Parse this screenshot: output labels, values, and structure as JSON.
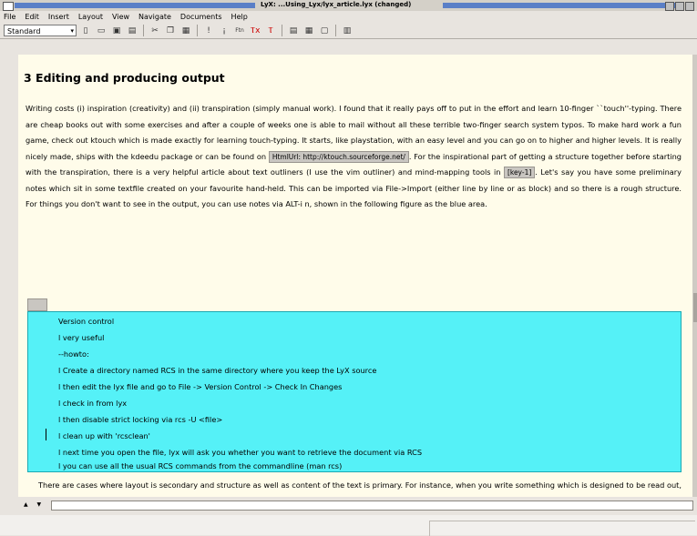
{
  "window": {
    "title": "LyX: ...Using_Lyx/lyx_article.lyx (changed)"
  },
  "menu": [
    "File",
    "Edit",
    "Insert",
    "Layout",
    "View",
    "Navigate",
    "Documents",
    "Help"
  ],
  "toolbar": {
    "layout_value": "Standard",
    "dropdown_arrow": "▾",
    "icons": [
      "new-icon",
      "open-icon",
      "save-icon",
      "print-icon",
      "cut-icon",
      "copy-icon",
      "paste-icon",
      "emph-icon",
      "noun-icon",
      "footnote-icon",
      "math-icon",
      "tex-icon",
      "table-icon",
      "figure-icon",
      "minipage-icon",
      "list-icon"
    ],
    "glyphs": {
      "new": "▯",
      "open": "▭",
      "save": "▣",
      "print": "▤",
      "cut": "✂",
      "copy": "❐",
      "paste": "▦",
      "emph": "!",
      "noun": "¡",
      "footnote": "Ftn",
      "math": "Ⲧx",
      "tex": "Ⲧ",
      "table": "▤",
      "figure": "▦",
      "minipage": "▢",
      "list": "▥"
    }
  },
  "document": {
    "heading": "3   Editing and producing output",
    "para1_before_url": "Writing costs (i) inspiration (creativity) and (ii) transpiration (simply manual work). I found that it really pays off to put in the effort and learn 10-finger ``touch''-typing. There are cheap books out with some exercises and after a couple of weeks one is able to mail without all these terrible two-finger search system typos. To make hard work a fun game, check out ktouch which is made exactly for learning touch-typing. It starts, like playstation, with an easy level and you can go on to higher and higher levels. It is really nicely made, ships with the kdeedu package or can be found on",
    "url_inset": "HtmlUrl: http://ktouch.sourceforge.net/",
    "para1_middle": ". For the inspirational part of getting a structure together before starting with the transpiration, there is a very helpful article about text outliners (I use the vim outliner) and mind-mapping tools in",
    "ref_inset": "[key-1]",
    "para1_after": ". Let's say you have some preliminary notes which sit in some textfile created on your favourite hand-held. This can be imported via File->Import (either line by line or as block) and so there is a rough structure. For things you don't want to see in the output, you can use notes via ALT-i n, shown in the following figure as the blue area.",
    "note_lines": [
      "Version control",
      "l very useful",
      "--howto:",
      "l Create a directory named RCS in the same directory where you keep the LyX source",
      "l then edit the lyx file and go to File -> Version Control -> Check In Changes",
      "l check in from lyx",
      "l then disable strict locking via rcs -U <file>",
      "l clean up with 'rcsclean'",
      "l next time you open the file, lyx will ask you whether you want to retrieve the document via RCS",
      "l you can use all the usual RCS commands from the commandline (man rcs)"
    ],
    "para2": "There are cases where layout is secondary and structure as well as content of the text is primary. For instance, when you write something which is designed to be read out, it is really not important whether the headings are typeset with Haettenschweiler bold-fixed in slanted format with underlining, no one will notice. Also, in many reports, there won't be extra credits for cute layout. Even documents like CVs tend to be optimised for quick, structured access to the significant data, '. If on the other hand you are more into producing art with a wordprocessor, you are possibly"
  },
  "statusbar": {
    "spin": "▲ ▼",
    "command_value": ""
  },
  "colors": {
    "page": "#fffcea",
    "note": "#55f1f7",
    "title_stripe": "#5a7fc7"
  }
}
